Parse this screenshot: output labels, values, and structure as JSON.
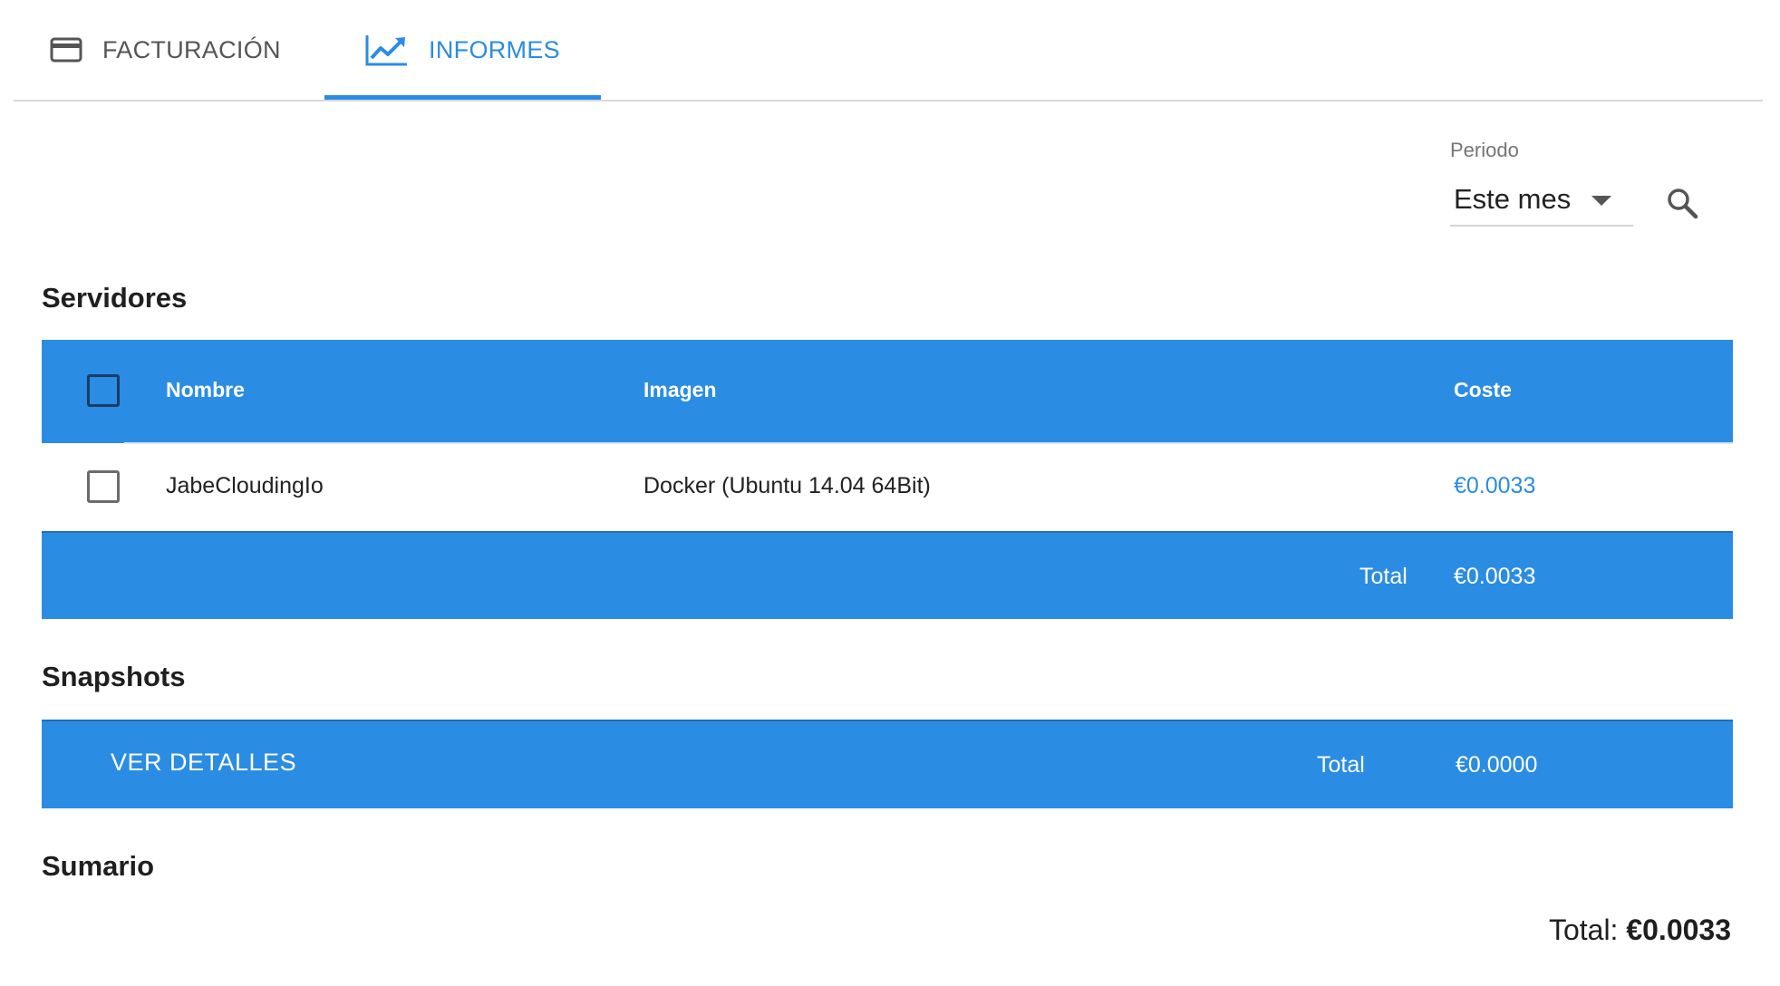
{
  "tabs": {
    "billing": {
      "label": "FACTURACIÓN",
      "icon": "credit-card-icon"
    },
    "reports": {
      "label": "INFORMES",
      "icon": "trending-up-icon",
      "active": true
    }
  },
  "filter": {
    "label": "Periodo",
    "value": "Este mes",
    "search_icon": "search-icon"
  },
  "servers": {
    "title": "Servidores",
    "columns": {
      "name": "Nombre",
      "image": "Imagen",
      "cost": "Coste"
    },
    "rows": [
      {
        "name": "JabeCloudingIo",
        "image": "Docker (Ubuntu 14.04 64Bit)",
        "cost": "€0.0033"
      }
    ],
    "total_label": "Total",
    "total_value": "€0.0033"
  },
  "snapshots": {
    "title": "Snapshots",
    "details_label": "VER DETALLES",
    "total_label": "Total",
    "total_value": "€0.0000"
  },
  "summary": {
    "title": "Sumario",
    "total_label": "Total:",
    "total_value": "€0.0033"
  },
  "colors": {
    "accent": "#2b8ce3",
    "text": "#1f1f1f",
    "muted": "#757575"
  }
}
